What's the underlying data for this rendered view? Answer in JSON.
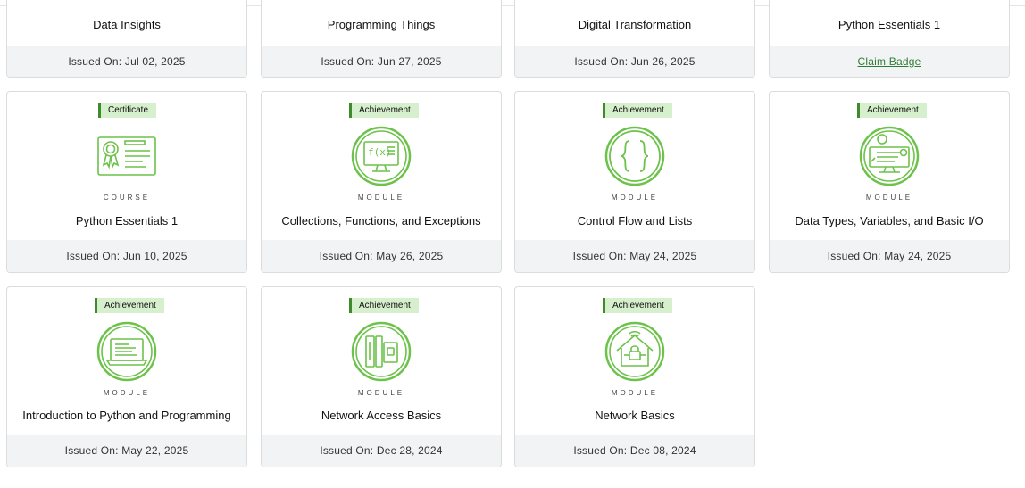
{
  "top_row": [
    {
      "title": "Data Insights",
      "issued": "Issued On: Jul 02, 2025"
    },
    {
      "title": "Programming Things",
      "issued": "Issued On: Jun 27, 2025"
    },
    {
      "title": "Digital Transformation",
      "issued": "Issued On: Jun 26, 2025"
    },
    {
      "title": "Python Essentials 1",
      "claim_label": "Claim Badge"
    }
  ],
  "cards": [
    {
      "badge": "Certificate",
      "type": "COURSE",
      "title": "Python Essentials 1",
      "issued": "Issued On: Jun 10, 2025",
      "icon": "certificate-icon"
    },
    {
      "badge": "Achievement",
      "type": "MODULE",
      "title": "Collections, Functions, and Exceptions",
      "issued": "Issued On: May 26, 2025",
      "icon": "function-monitor-icon"
    },
    {
      "badge": "Achievement",
      "type": "MODULE",
      "title": "Control Flow and Lists",
      "issued": "Issued On: May 24, 2025",
      "icon": "curly-braces-icon"
    },
    {
      "badge": "Achievement",
      "type": "MODULE",
      "title": "Data Types, Variables, and Basic I/O",
      "issued": "Issued On: May 24, 2025",
      "icon": "data-monitor-icon"
    },
    {
      "badge": "Achievement",
      "type": "MODULE",
      "title": "Introduction to Python and Programming",
      "issued": "Issued On: May 22, 2025",
      "icon": "laptop-code-icon"
    },
    {
      "badge": "Achievement",
      "type": "MODULE",
      "title": "Network Access Basics",
      "issued": "Issued On: Dec 28, 2024",
      "icon": "server-rack-icon"
    },
    {
      "badge": "Achievement",
      "type": "MODULE",
      "title": "Network Basics",
      "issued": "Issued On: Dec 08, 2024",
      "icon": "smart-home-icon"
    }
  ],
  "colors": {
    "accent": "#6cc24a",
    "badge_bg": "#d6efcc",
    "badge_border": "#3f8a2c",
    "footer_bg": "#f2f3f5"
  }
}
